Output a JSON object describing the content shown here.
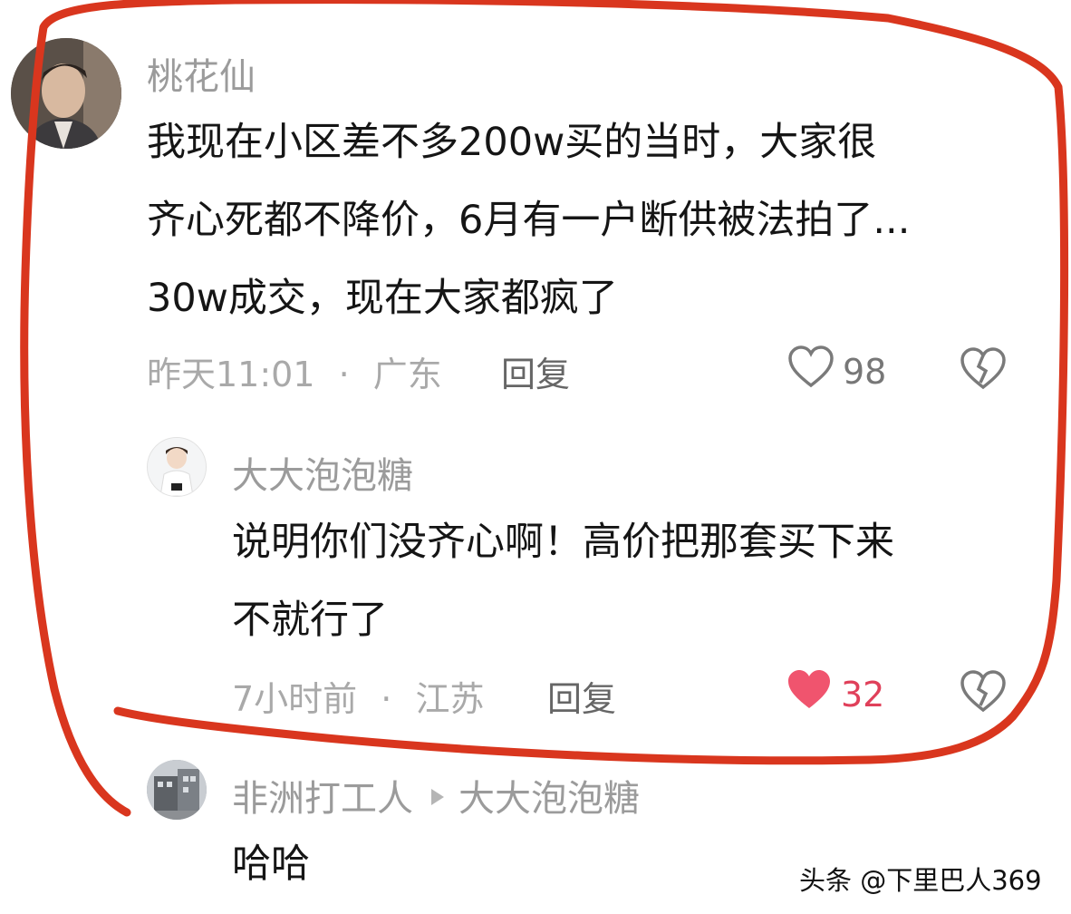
{
  "comment": {
    "username": "桃花仙",
    "lines": [
      "我现在小区差不多200w买的当时，大家很",
      "齐心死都不降价，6月有一户断供被法拍了...",
      "30w成交，现在大家都疯了"
    ],
    "time": "昨天11:01",
    "location": "广东",
    "reply_label": "回复",
    "like_count": "98"
  },
  "reply": {
    "username": "大大泡泡糖",
    "lines": [
      "说明你们没齐心啊！高价把那套买下来",
      "不就行了"
    ],
    "time": "7小时前",
    "location": "江苏",
    "reply_label": "回复",
    "like_count": "32",
    "liked": true
  },
  "sub_reply": {
    "username": "非洲打工人",
    "reply_to": "大大泡泡糖",
    "text": "哈哈"
  },
  "meta_separator": "·",
  "watermark": "头条 @下里巴人369",
  "colors": {
    "annotation_stroke": "#d9361e",
    "liked_heart": "#f0546e"
  },
  "icons": {
    "like": "heart-outline-icon",
    "liked": "heart-filled-icon",
    "dislike": "broken-heart-icon",
    "reply_to": "triangle-right-icon"
  }
}
